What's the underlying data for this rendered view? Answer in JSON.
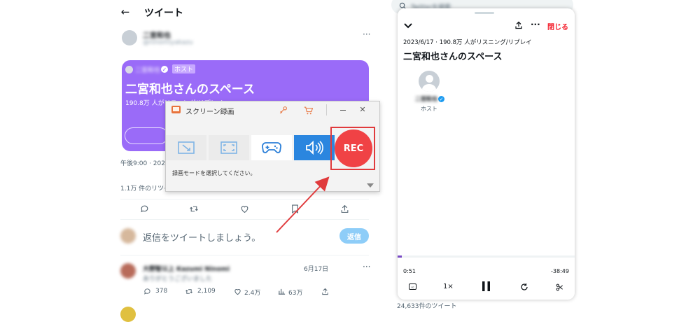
{
  "tweet": {
    "title": "ツイート",
    "user_name": "二宮和也",
    "user_handle": "@ninomiyakazu",
    "space_card": {
      "host_name": "二宮和也",
      "host_badge": "ホスト",
      "title": "二宮和也さんのスペース",
      "stats": "190.8万 人がリスニング/リプレイ"
    },
    "timestamp": "午後9:00 · 2023年",
    "retweets_text": "1.1万 件のリツイート",
    "reply_placeholder": "返信をツイートしましょう。",
    "reply_button": "返信",
    "reply": {
      "user": "大野智以上 Kazumi Ninomi",
      "date": "6月17日",
      "text": "ありがとうございました",
      "counts": {
        "replies": "378",
        "retweets": "2,109",
        "likes": "2.4万",
        "views": "63万"
      }
    }
  },
  "recorder": {
    "title": "スクリーン録画",
    "hint": "録画モードを選択してください。",
    "rec_label": "REC",
    "accent": "#e8393b"
  },
  "space_panel": {
    "close_label": "閉じる",
    "stats": "2023/6/17 · 190.8万 人がリスニング/リプレイ",
    "title": "二宮和也さんのスペース",
    "host_name": "二宮和也",
    "host_role": "ホスト",
    "time_elapsed": "0:51",
    "time_remaining": "-38:49",
    "speed": "1×",
    "progress": 0.024,
    "tweet_count": "24,633件のツイート",
    "search_placeholder": "Twitterを検索"
  }
}
